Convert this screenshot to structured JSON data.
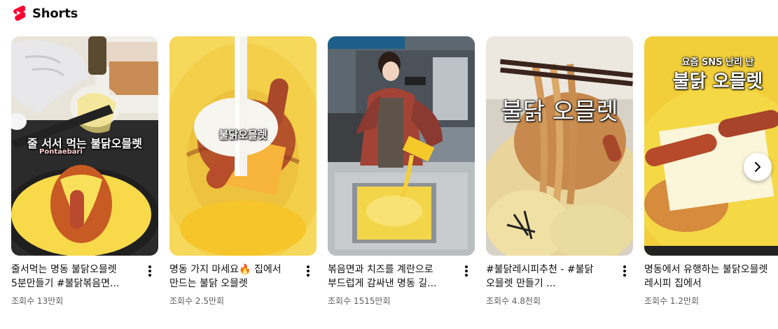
{
  "header": {
    "title": "Shorts",
    "logo_color": "#ff0033",
    "icon": "shorts-logo-icon"
  },
  "cards": [
    {
      "title": "줄서먹는 명동 불닭오믈렛 5분만들기 #불닭볶음면...",
      "views": "조회수 13만회",
      "overlay": "줄 서서 먹는 불닭오믈렛",
      "watermark": "Pontaebari"
    },
    {
      "title": "명동 가지 마세요🔥 집에서 만드는 불닭 오믈렛",
      "views": "조회수 2.5만회",
      "overlay": "불닭오믈렛"
    },
    {
      "title": "볶음면과 치즈를 계란으로 부드럽게 감싸낸 명동 길...",
      "views": "조회수 1515만회"
    },
    {
      "title": "#불닭레시피추천 - #불닭 오믈렛 만들기 ...",
      "views": "조회수 4.8천회",
      "overlay": "불닭 오믈렛"
    },
    {
      "title": "명동에서 유행하는 불닭오믈렛 레시피 집에서",
      "views": "조회수 1.2만회",
      "overlay_top": "요즘 SNS 난리 난",
      "overlay": "불닭 오믈렛"
    }
  ],
  "next_button_icon": "chevron-right-icon",
  "more_icon": "more-vert-icon"
}
